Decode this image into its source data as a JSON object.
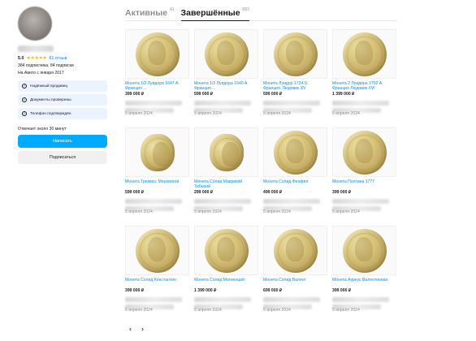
{
  "seller": {
    "rating": "5.0",
    "stars": "★★★★★",
    "reviews": "81 отзыв",
    "followers": "384 подписчика, 84 подписки",
    "since": "На Авито с января 2017",
    "badges": [
      {
        "label": "Надёжный продавец",
        "icon": "check-circle-icon"
      },
      {
        "label": "Документы проверены",
        "icon": "check-circle-icon"
      },
      {
        "label": "Телефон подтверждён",
        "icon": "check-circle-icon"
      }
    ],
    "reply_time": "Отвечает около 30 минут",
    "write_button": "Написать",
    "subscribe_button": "Подписаться"
  },
  "tabs": [
    {
      "label": "Активные",
      "count": "41"
    },
    {
      "label": "Завершённые",
      "count": "683"
    }
  ],
  "listings": [
    {
      "title": "Монета 1/2 Луидора 1647 А. Франция ...",
      "price": "399 000 ₽",
      "date": "5 апреля 2024"
    },
    {
      "title": "Монета 1/2 Луидора 1640 А. Франция ...",
      "price": "599 000 ₽",
      "date": "5 апреля 2024"
    },
    {
      "title": "Монета Луидор 1724 S. Франция. Людовик XV",
      "price": "599 000 ₽",
      "date": "5 апреля 2024"
    },
    {
      "title": "Монета 2 Луидора 1792 А. Франция Людовик XVI",
      "price": "1 399 000 ₽",
      "date": "5 апреля 2024"
    },
    {
      "title": "Монета Тремисс Меровинги",
      "price": "599 000 ₽",
      "date": "5 апреля 2024"
    },
    {
      "title": "Монета Солид Маврикий Тиберий",
      "price": "299 000 ₽",
      "date": "5 апреля 2024"
    },
    {
      "title": "Монета Солид Феофил",
      "price": "499 000 ₽",
      "date": "5 апреля 2024"
    },
    {
      "title": "Монета Полтина 1777",
      "price": "399 000 ₽",
      "date": "5 апреля 2024"
    },
    {
      "title": "Монета Солид Константин",
      "price": "399 000 ₽",
      "date": "5 апреля 2024"
    },
    {
      "title": "Монета Солид Магненций",
      "price": "1 399 000 ₽",
      "date": "5 апреля 2024"
    },
    {
      "title": "Монета Солид Валент",
      "price": "699 000 ₽",
      "date": "5 апреля 2024"
    },
    {
      "title": "Монета Ауреус Валентиниан",
      "price": "399 000 ₽",
      "date": "5 апреля 2024"
    }
  ],
  "pager": {
    "prev": "‹",
    "next": "›"
  }
}
